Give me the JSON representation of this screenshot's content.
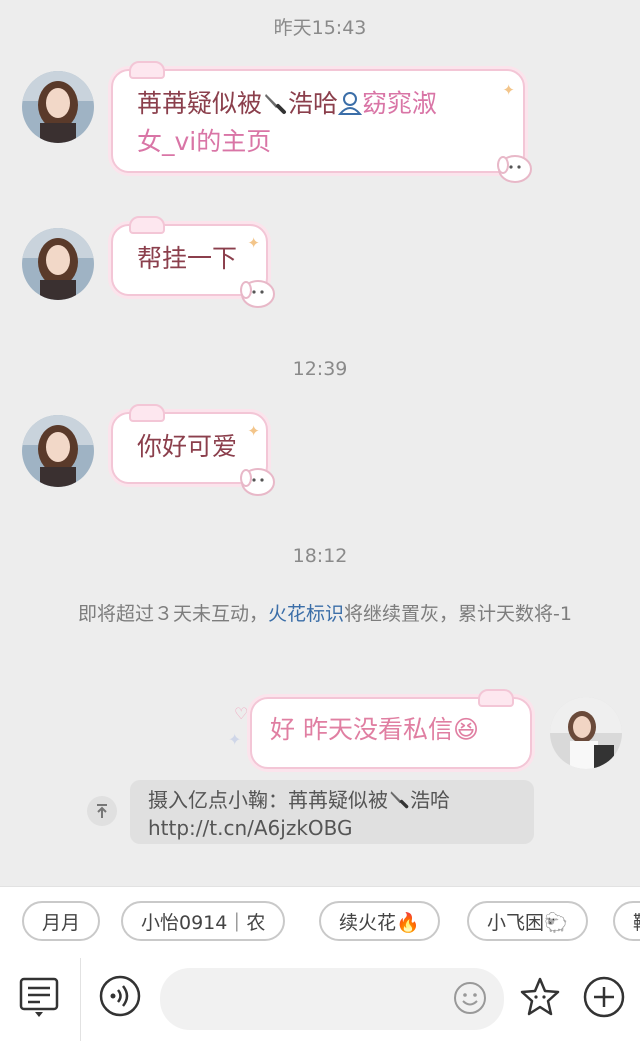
{
  "timestamps": [
    "昨天15:43",
    "12:39",
    "18:12"
  ],
  "messages": {
    "m1": {
      "line1_a": "苒苒疑似被",
      "line1_b": "浩哈",
      "line1_c": "窈窕淑",
      "line2": "女_vi的主页"
    },
    "m2": "帮挂一下",
    "m3": "你好可爱",
    "out": {
      "text": "好 昨天没看私信",
      "emoji": "😆"
    }
  },
  "system_notice": {
    "part1": "即将超过３天未互动，",
    "link": "火花标识",
    "part2": "将继续置灰，累计天数将-1"
  },
  "quote": {
    "line1_a": "摄入亿点小鞠：苒苒疑似被",
    "line1_b": "浩哈",
    "line2": "http://t.cn/A6jzkOBG"
  },
  "quick_replies": [
    "月月",
    "小怡0914｜农",
    "续火花🔥",
    "小飞困🐑",
    "靴"
  ],
  "colors": {
    "background": "#ededed",
    "incoming_text": "#8b3f4c",
    "outgoing_text": "#e07fa2",
    "link": "#3b6ea8",
    "bubble_border": "#f3c6d6"
  },
  "icons": [
    "menu-icon",
    "voice-icon",
    "emoji-icon",
    "star-sticker-icon",
    "plus-icon",
    "knife-icon",
    "user-icon",
    "upload-icon"
  ]
}
